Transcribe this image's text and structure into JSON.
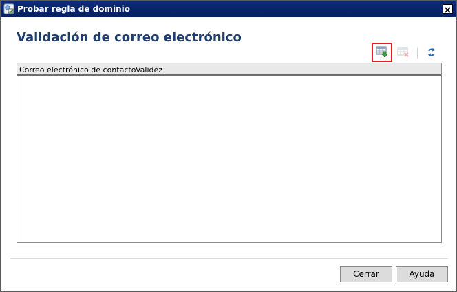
{
  "window": {
    "title": "Probar regla de dominio",
    "app_icon": "domain-rule-icon",
    "close_icon": "close-icon"
  },
  "main": {
    "heading": "Validación de correo electrónico",
    "toolbar": {
      "export_icon": "export-list-icon",
      "clear_icon": "clear-list-icon",
      "refresh_icon": "refresh-icon"
    },
    "grid": {
      "columns": [
        "Correo electrónico de contacto",
        "Validez"
      ],
      "rows": []
    }
  },
  "footer": {
    "close_label": "Cerrar",
    "help_label": "Ayuda"
  },
  "colors": {
    "titlebar": "#0a246a",
    "heading": "#1f3e6e",
    "highlight": "#e31e24"
  }
}
